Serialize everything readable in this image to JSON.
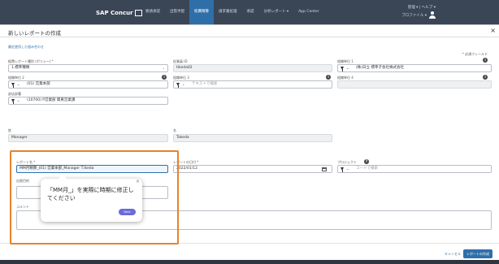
{
  "nav": {
    "logo": "SAP Concur",
    "items": [
      {
        "label": "要請承認"
      },
      {
        "label": "出張手配"
      },
      {
        "label": "経費精算"
      },
      {
        "label": "請求書処理"
      },
      {
        "label": "承認"
      },
      {
        "label": "分析レポート ▾"
      },
      {
        "label": "App Center"
      }
    ],
    "utility_top": "管理 ▾  |  ヘルプ ▾",
    "profile": "プロファイル ▾"
  },
  "modal": {
    "title": "新しいレポートの作成",
    "close": "×",
    "link": "最近使用した組み合わせ",
    "required_note": "* 必須フィールド",
    "fields": {
      "policy": {
        "label": "経費レポート種別 (ポリシー) *",
        "value": "1.標準種類"
      },
      "employee_id": {
        "label": "従業員 ID",
        "value": "tikeda02"
      },
      "org1": {
        "label": "組織単位 1",
        "value": "(株)日立 標準子会社株式会社"
      },
      "org2": {
        "label": "組織単位 2",
        "value": "(01) 営業本部"
      },
      "org3": {
        "label": "組織単位 3",
        "value": "テキストで検索"
      },
      "org4": {
        "label": "組織単位 4",
        "value": ""
      },
      "department": {
        "label": "部店部署",
        "value": "(10700) P営業部 関東営業課"
      },
      "last_name": {
        "label": "姓",
        "value": "Manager"
      },
      "first_name": {
        "label": "名",
        "value": "Takeda"
      },
      "report_name": {
        "label": "レポート名 *",
        "value": "MM月精算_(01) 営業本部_Manager T.Ikeda"
      },
      "report_date": {
        "label": "レポートの日付 *",
        "value": "2022/01/12"
      },
      "project": {
        "label": "プロジェクト",
        "value": "コードで検索"
      },
      "business_purpose": {
        "label": "出張目的"
      },
      "comment": {
        "label": "コメント"
      }
    },
    "tooltip": {
      "text": "「MM月_」を実際に時期に修正してください",
      "close": "×",
      "button": "Next"
    },
    "footer": {
      "cancel": "キャンセル",
      "create": "レポートの作成"
    }
  },
  "colors": {
    "accent": "#2f6fa9",
    "highlight": "#e8832a",
    "tooltip_button": "#6b6bd9",
    "nav_bg": "#3a4556"
  }
}
